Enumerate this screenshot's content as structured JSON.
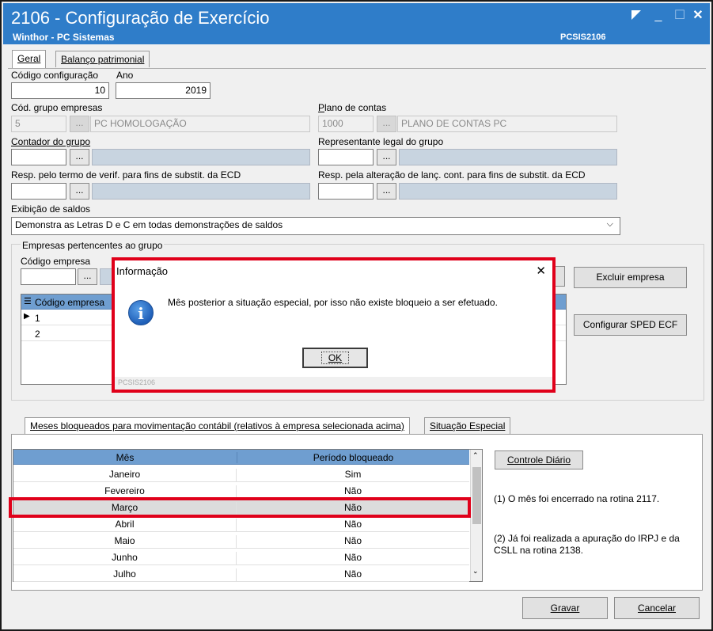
{
  "window": {
    "title": "2106 - Configuração de Exercício",
    "subtitle": "Winthor - PC Sistemas",
    "code": "PCSIS2106",
    "buttons": {
      "resize_icon": "resize-icon",
      "minimize": "_",
      "maximize": "☐",
      "close": "✕"
    }
  },
  "tabs": {
    "geral": "Geral",
    "balanco": "Balanço patrimonial"
  },
  "form": {
    "codigo_config_label": "Código configuração",
    "codigo_config_value": "10",
    "ano_label": "Ano",
    "ano_value": "2019",
    "cod_grupo_label": "Cód. grupo empresas",
    "cod_grupo_value": "5",
    "cod_grupo_desc": "PC HOMOLOGAÇÃO",
    "plano_label": "Plano de contas",
    "plano_value": "1000",
    "plano_desc": "PLANO DE CONTAS PC",
    "contador_label": "Contador do grupo",
    "representante_label": "Representante legal do grupo",
    "resp_termo_label": "Resp. pelo termo de verif. para fins de substit. da ECD",
    "resp_alteracao_label": "Resp. pela alteração de lanç. cont. para fins de substit. da ECD",
    "exibicao_label": "Exibição de saldos",
    "exibicao_value": "Demonstra as Letras D e C em todas demonstrações de saldos",
    "dots": "..."
  },
  "empresas": {
    "group_label": "Empresas pertencentes ao grupo",
    "codigo_label": "Código empresa",
    "excluir_button": "Excluir empresa",
    "sped_button": "Configurar SPED ECF",
    "grid_header": "Código empresa",
    "rows": [
      "1",
      "2"
    ]
  },
  "dialog": {
    "title": "Informação",
    "message": "Mês posterior a situação especial, por isso não existe bloqueio a ser efetuado.",
    "ok": "OK",
    "footer": "PCSIS2106",
    "close": "✕"
  },
  "meses": {
    "tab_meses": "Meses bloqueados para movimentação contábil (relativos à empresa selecionada acima)",
    "tab_situacao": "Situação Especial",
    "col_mes": "Mês",
    "col_periodo": "Período bloqueado",
    "rows": [
      {
        "mes": "Janeiro",
        "periodo": "Sim"
      },
      {
        "mes": "Fevereiro",
        "periodo": "Não"
      },
      {
        "mes": "Março",
        "periodo": "Não"
      },
      {
        "mes": "Abril",
        "periodo": "Não"
      },
      {
        "mes": "Maio",
        "periodo": "Não"
      },
      {
        "mes": "Junho",
        "periodo": "Não"
      },
      {
        "mes": "Julho",
        "periodo": "Não"
      }
    ],
    "controle_button": "Controle Diário",
    "note1": "(1)  O mês foi encerrado na rotina 2117.",
    "note2_line1": "(2)  Já foi realizada a apuração do IRPJ e da",
    "note2_line2": "CSLL na rotina 2138."
  },
  "footer": {
    "gravar": "Gravar",
    "cancelar": "Cancelar"
  },
  "colors": {
    "titlebar": "#2f7dc9",
    "highlight": "#e0001a",
    "grid_header": "#6f9ed0"
  }
}
